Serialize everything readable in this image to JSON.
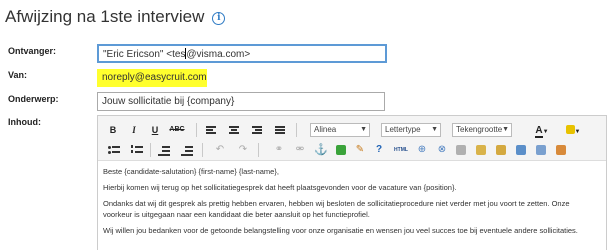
{
  "page": {
    "title": "Afwijzing na 1ste interview",
    "info_icon_glyph": "i"
  },
  "form": {
    "recipient_label": "Ontvanger:",
    "recipient_value_before": "\"Eric Ericson\" <tes",
    "recipient_value_after": "@visma.com>",
    "from_label": "Van:",
    "from_value": "noreply@easycruit.com",
    "subject_label": "Onderwerp:",
    "subject_value": "Jouw sollicitatie bij {company}",
    "content_label": "Inhoud:"
  },
  "toolbar": {
    "bold": "B",
    "italic": "I",
    "underline": "U",
    "strike": "ABC",
    "paragraph_select": "Alinea",
    "font_select": "Lettertype",
    "size_select": "Tekengrootte",
    "text_color": "A",
    "html_button": "HTML"
  },
  "body": {
    "line1": "Beste {candidate-salutation} {first-name} {last-name},",
    "line2": "Hierbij komen wij terug op het sollicitatiegesprek dat heeft plaatsgevonden voor de vacature van {position}.",
    "line3a": "Ondanks dat wij dit gesprek als prettig hebben ervaren, hebben wij besloten de sollicitatieprocedure niet verder met jou voort te zetten. Onze",
    "line3b": "voorkeur is uitgegaan naar een kandidaat die beter aansluit op het functieprofiel.",
    "line4": "Wij willen jou bedanken voor de getoonde belangstelling voor onze organisatie en wensen jou veel succes toe bij eventuele andere sollicitaties."
  },
  "colors": {
    "highlight": "#ffff2e",
    "focus_border": "#5d9ad6",
    "info_icon": "#2f7bc4"
  }
}
